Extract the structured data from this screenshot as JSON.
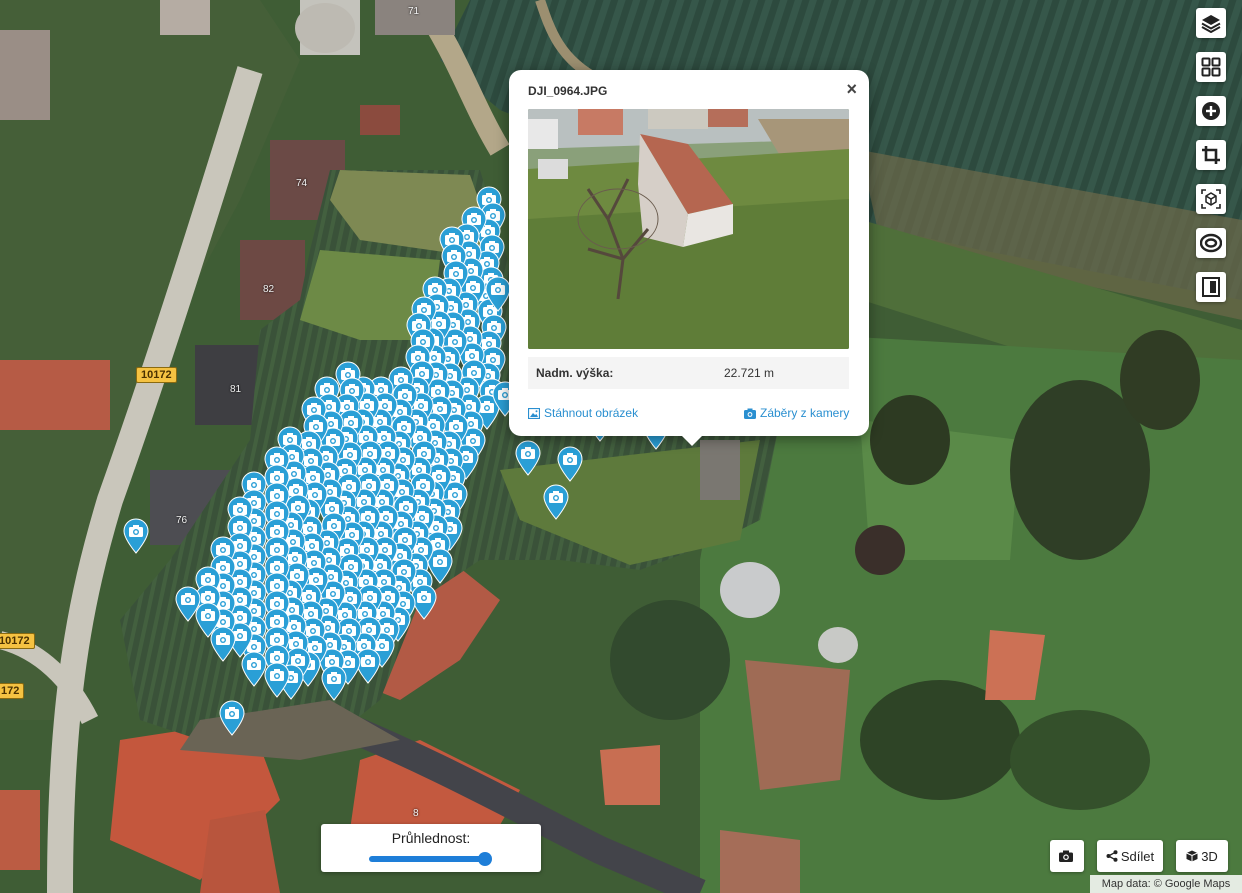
{
  "map": {
    "house_numbers": [
      "71",
      "74",
      "82",
      "81",
      "76",
      "8"
    ],
    "road_shields": [
      "10172",
      "10172",
      "172"
    ],
    "attribution": "Map data: © Google Maps"
  },
  "popup": {
    "filename": "DJI_0964.JPG",
    "close_symbol": "×",
    "altitude_label": "Nadm. výška:",
    "altitude_value": "22.721 m",
    "download_label": "Stáhnout obrázek",
    "camera_shots_label": "Záběry z kamery"
  },
  "toolbar": {
    "icons": [
      "layers-icon",
      "grid-icon",
      "plus-circle-icon",
      "crop-icon",
      "3d-box-icon",
      "ellipse-icon",
      "film-icon"
    ]
  },
  "opacity": {
    "label": "Průhlednost:",
    "value_percent": 95
  },
  "buttons": {
    "camera_label": "",
    "share_label": "Sdílet",
    "view3d_label": "3D"
  },
  "colors": {
    "marker": "#2a9fd6",
    "link": "#2a8fd0",
    "slider": "#1e7ed8"
  }
}
